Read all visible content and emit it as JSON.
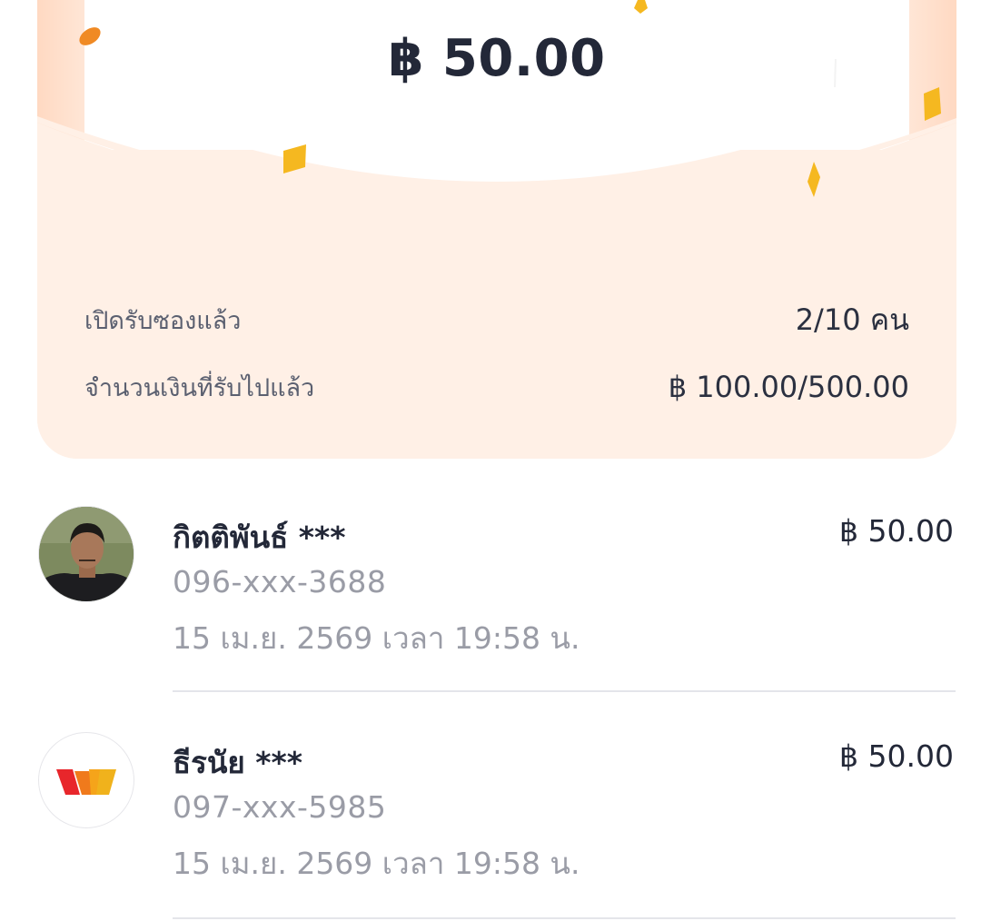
{
  "envelope": {
    "amount": "฿ 50.00",
    "opened_label": "เปิดรับซองแล้ว",
    "opened_value": "2/10 คน",
    "received_label": "จำนวนเงินที่รับไปแล้ว",
    "received_value": "฿ 100.00/500.00"
  },
  "recipients": [
    {
      "name": "กิตติพันธ์ ***",
      "phone": "096-xxx-3688",
      "time": "15 เม.ย. 2569 เวลา 19:58 น.",
      "amount": "฿ 50.00",
      "avatar": "user-photo"
    },
    {
      "name": "ธีรนัย ***",
      "phone": "097-xxx-5985",
      "time": "15 เม.ย. 2569 เวลา 19:58 น.",
      "amount": "฿ 50.00",
      "avatar": "truemoney-logo"
    }
  ],
  "colors": {
    "card_background": "#fff0e6",
    "confetti_yellow": "#f5b820",
    "confetti_orange": "#f08a24",
    "text_primary": "#232838",
    "text_secondary": "#9a9ca6"
  }
}
